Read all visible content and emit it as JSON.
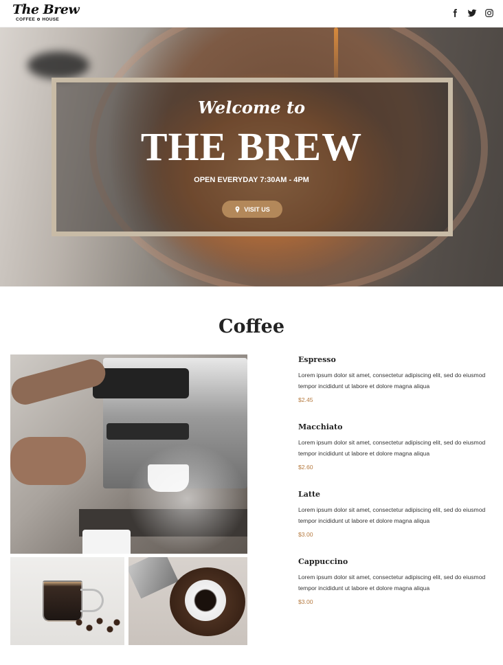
{
  "header": {
    "logo_script": "The Brew",
    "logo_left": "COFFEE",
    "logo_right": "HOUSE",
    "social": [
      {
        "name": "facebook-icon"
      },
      {
        "name": "twitter-icon"
      },
      {
        "name": "instagram-icon"
      }
    ]
  },
  "hero": {
    "welcome": "Welcome to",
    "title": "THE BREW",
    "hours": "OPEN EVERYDAY 7:30AM - 4PM",
    "visit_label": "VISIT US",
    "visit_icon": "map-pin-icon",
    "accent": "#b3885a",
    "frame_color": "#c8bba6"
  },
  "coffee": {
    "title": "Coffee",
    "items": [
      {
        "name": "Espresso",
        "desc": "Lorem ipsum dolor sit amet, consectetur adipiscing elit, sed do eiusmod tempor incididunt ut labore et dolore magna aliqua",
        "price": "$2.45"
      },
      {
        "name": "Macchiato",
        "desc": "Lorem ipsum dolor sit amet, consectetur adipiscing elit, sed do eiusmod tempor incididunt ut labore et dolore magna aliqua",
        "price": "$2.60"
      },
      {
        "name": "Latte",
        "desc": "Lorem ipsum dolor sit amet, consectetur adipiscing elit, sed do eiusmod tempor incididunt ut labore et dolore magna aliqua",
        "price": "$3.00"
      },
      {
        "name": "Cappuccino",
        "desc": "Lorem ipsum dolor sit amet, consectetur adipiscing elit, sed do eiusmod tempor incididunt ut labore et dolore magna aliqua",
        "price": "$3.00"
      }
    ],
    "price_color": "#b5793e"
  }
}
